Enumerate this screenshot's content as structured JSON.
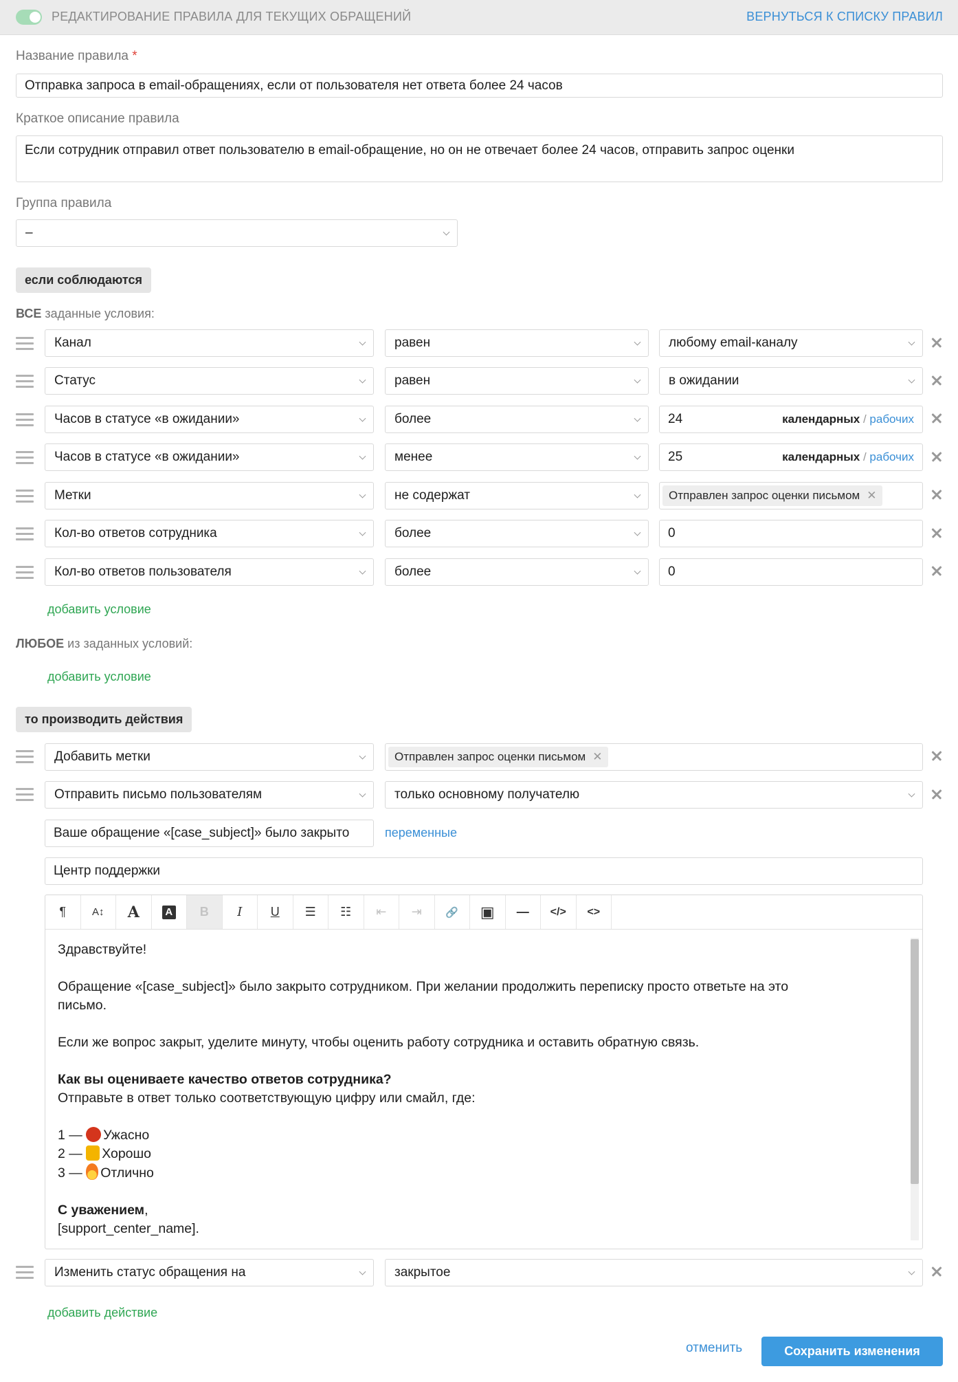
{
  "header": {
    "title": "РЕДАКТИРОВАНИЕ ПРАВИЛА ДЛЯ ТЕКУЩИХ ОБРАЩЕНИЙ",
    "back_link": "ВЕРНУТЬСЯ К СПИСКУ ПРАВИЛ",
    "toggle_on": true,
    "toggle_color": "#a6dcb7"
  },
  "form": {
    "name_label": "Название правила",
    "name_required_mark": "*",
    "name_value": "Отправка запроса в email-обращениях, если от пользователя нет ответа более 24 часов",
    "description_label": "Краткое описание правила",
    "description_value": "Если сотрудник отправил ответ пользователю в email-обращение, но он не отвечает более 24 часов, отправить запрос оценки",
    "group_label": "Группа правила",
    "group_value": "–"
  },
  "conditions": {
    "section_label": "если соблюдаются",
    "all_prefix": "ВСЕ",
    "all_suffix": "заданные условия:",
    "rows": [
      {
        "field": "Канал",
        "operator": "равен",
        "value": "любому email-каналу"
      },
      {
        "field": "Статус",
        "operator": "равен",
        "value": "в ожидании"
      },
      {
        "field": "Часов в статусе «в ожидании»",
        "operator": "более",
        "value": "24",
        "unit_calendar": "календарных",
        "unit_sep": "/",
        "unit_work": "рабочих"
      },
      {
        "field": "Часов в статусе «в ожидании»",
        "operator": "менее",
        "value": "25",
        "unit_calendar": "календарных",
        "unit_sep": "/",
        "unit_work": "рабочих"
      },
      {
        "field": "Метки",
        "operator": "не содержат",
        "tag": "Отправлен запрос оценки письмом"
      },
      {
        "field": "Кол-во ответов сотрудника",
        "operator": "более",
        "value": "0"
      },
      {
        "field": "Кол-во ответов пользователя",
        "operator": "более",
        "value": "0"
      }
    ],
    "add_condition": "добавить условие",
    "any_prefix": "ЛЮБОЕ",
    "any_suffix": "из заданных условий:",
    "add_condition_any": "добавить условие"
  },
  "actions": {
    "section_label": "то производить действия",
    "add_tags": {
      "action": "Добавить метки",
      "tag": "Отправлен запрос оценки письмом"
    },
    "send_email": {
      "action": "Отправить письмо пользователям",
      "recipient": "только основному получателю",
      "subject": "Ваше обращение «[case_subject]» было закрыто",
      "variables_link": "переменные",
      "sender": "Центр поддержки"
    },
    "change_status": {
      "action": "Изменить статус обращения на",
      "value": "закрытое"
    },
    "add_action": "добавить действие"
  },
  "editor": {
    "toolbar": [
      {
        "glyph": "¶",
        "name": "paragraph-icon"
      },
      {
        "glyph": "A↕",
        "name": "font-size-icon"
      },
      {
        "glyph": "A",
        "name": "font-color-icon"
      },
      {
        "glyph": "A",
        "name": "highlight-icon"
      },
      {
        "glyph": "B",
        "name": "bold-icon"
      },
      {
        "glyph": "I",
        "name": "italic-icon"
      },
      {
        "glyph": "U",
        "name": "underline-icon"
      },
      {
        "glyph": "☰",
        "name": "bullet-list-icon"
      },
      {
        "glyph": "☷",
        "name": "numbered-list-icon"
      },
      {
        "glyph": "⇤",
        "name": "outdent-icon"
      },
      {
        "glyph": "⇥",
        "name": "indent-icon"
      },
      {
        "glyph": "🔗",
        "name": "link-icon"
      },
      {
        "glyph": "▣",
        "name": "image-icon"
      },
      {
        "glyph": "—",
        "name": "horizontal-rule-icon"
      },
      {
        "glyph": "</>",
        "name": "code-block-icon"
      },
      {
        "glyph": "<>",
        "name": "html-source-icon"
      }
    ],
    "greeting": "Здравствуйте!",
    "line1": "Обращение «[case_subject]» было закрыто сотрудником. При желании продолжить переписку просто ответьте на это",
    "line1b": "письмо.",
    "line2": "Если же вопрос закрыт, уделите минуту, чтобы оценить работу сотрудника и оставить обратную связь.",
    "question": "Как вы оцениваете качество ответов сотрудника?",
    "instruction": "Отправьте в ответ только соответствующую цифру или смайл, где:",
    "opt1_num": "1 —",
    "opt1_label": "Ужасно",
    "opt2_num": "2 —",
    "opt2_label": "Хорошо",
    "opt3_num": "3 —",
    "opt3_label": "Отлично",
    "regards": "С уважением",
    "regards_comma": ",",
    "signature": "[support_center_name]."
  },
  "footer": {
    "cancel": "отменить",
    "save": "Сохранить изменения"
  },
  "colors": {
    "accent": "#3a8fd6",
    "save_button": "#3d9be0",
    "add_link": "#2fa653",
    "required": "#e0433a"
  }
}
